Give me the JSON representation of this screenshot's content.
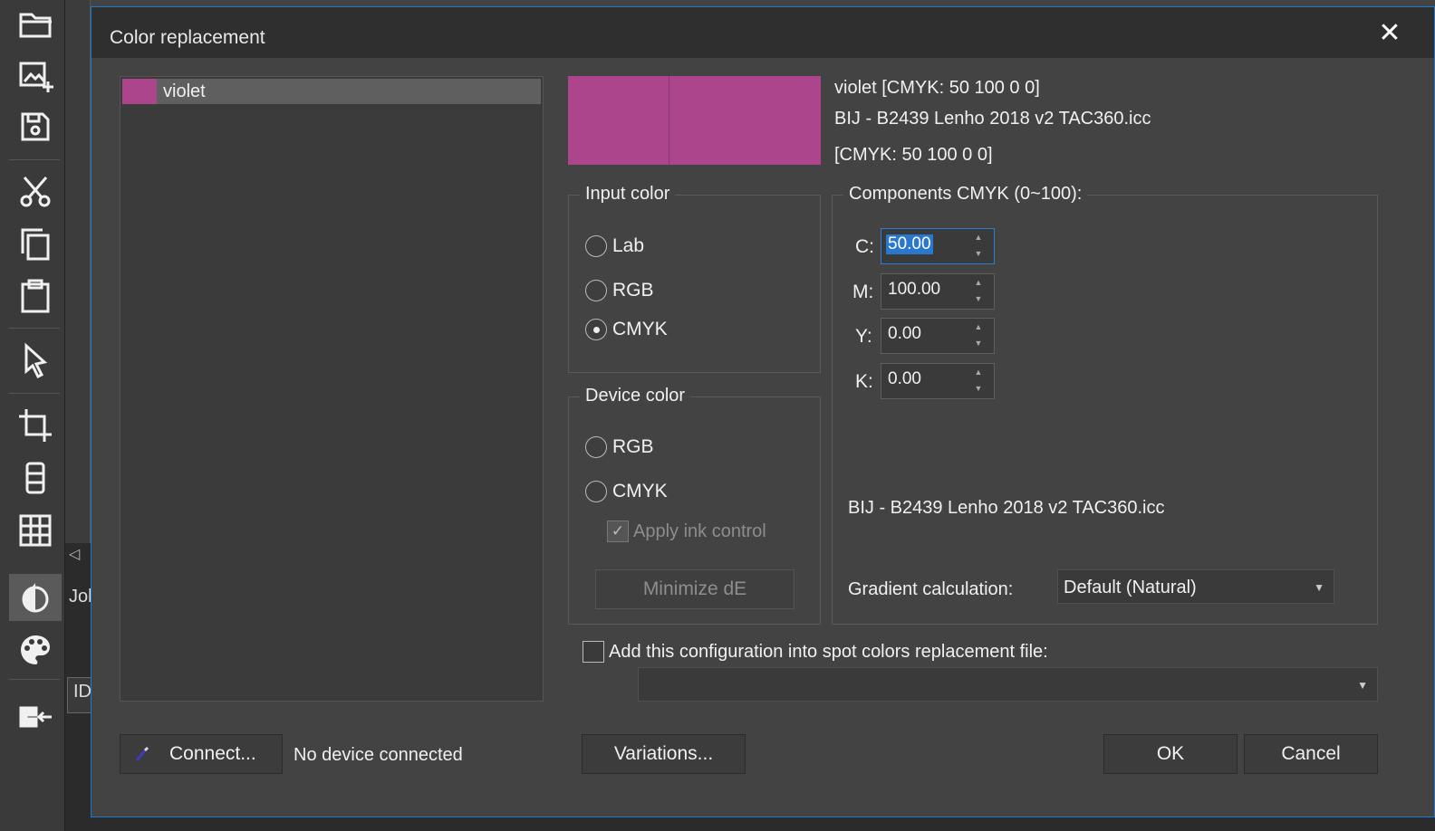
{
  "dialog": {
    "title": "Color replacement",
    "close_glyph": "✕"
  },
  "app_side": {
    "jol_text": "Jol",
    "id_text": "ID"
  },
  "color_list": {
    "items": [
      {
        "label": "violet",
        "color": "#ac458b"
      }
    ]
  },
  "preview": {
    "color": "#ac458b",
    "info_name": "violet  [CMYK: 50 100 0 0]",
    "info_profile": "BIJ - B2439 Lenho 2018 v2 TAC360.icc",
    "info_values": "[CMYK: 50 100 0 0]"
  },
  "input_color": {
    "title": "Input color",
    "options": [
      "Lab",
      "RGB",
      "CMYK"
    ],
    "selected": "CMYK"
  },
  "device_color": {
    "title": "Device color",
    "options": [
      "RGB",
      "CMYK"
    ],
    "apply_ink_control": "Apply ink control",
    "minimize_button": "Minimize dE"
  },
  "components": {
    "title": "Components CMYK (0~100):",
    "fields": [
      {
        "label": "C:",
        "value": "50.00"
      },
      {
        "label": "M:",
        "value": "100.00"
      },
      {
        "label": "Y:",
        "value": "0.00"
      },
      {
        "label": "K:",
        "value": "0.00"
      }
    ],
    "profile": "BIJ - B2439 Lenho 2018 v2 TAC360.icc",
    "gradient_label": "Gradient calculation:",
    "gradient_value": "Default (Natural)"
  },
  "spot_config": {
    "label": "Add this configuration into spot colors replacement file:",
    "file_value": ""
  },
  "footer": {
    "connect_button": "Connect...",
    "device_status": "No device connected",
    "variations_button": "Variations...",
    "ok_button": "OK",
    "cancel_button": "Cancel"
  },
  "colors": {
    "accent": "#1a7ad3",
    "violet": "#ac458b"
  }
}
